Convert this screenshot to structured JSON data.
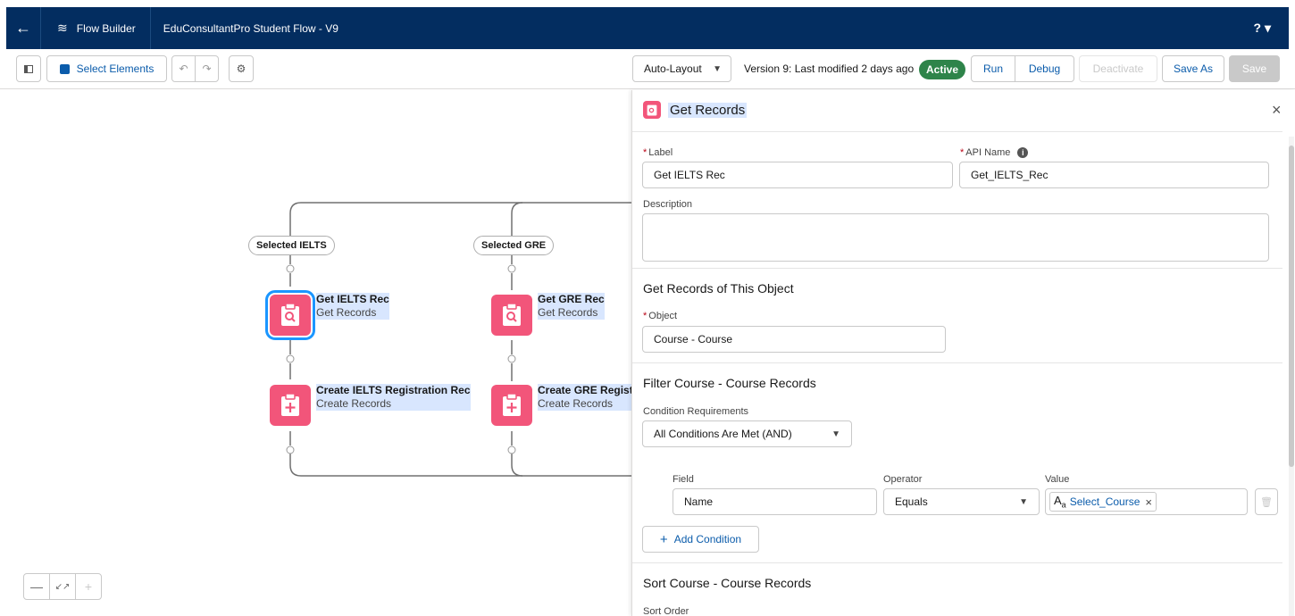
{
  "header": {
    "back_icon": "arrow-left-icon",
    "app_icon": "flow-icon",
    "app_name": "Flow Builder",
    "flow_title": "EduConsultantPro Student Flow - V9",
    "help": "?"
  },
  "toolbar": {
    "select_elements": "Select Elements",
    "layout": "Auto-Layout",
    "version_text": "Version 9: Last modified 2 days ago",
    "status": "Active",
    "run": "Run",
    "debug": "Debug",
    "deactivate": "Deactivate",
    "save_as": "Save As",
    "save": "Save"
  },
  "canvas": {
    "branches": [
      {
        "label": "Selected IELTS",
        "get_title": "Get IELTS Rec",
        "get_type": "Get Records",
        "create_title": "Create IELTS Registration Rec",
        "create_type": "Create Records"
      },
      {
        "label": "Selected GRE",
        "get_title": "Get GRE Rec",
        "get_type": "Get Records",
        "create_title": "Create GRE Regist",
        "create_type": "Create Records"
      }
    ]
  },
  "panel": {
    "title": "Get Records",
    "label_label": "Label",
    "label_value": "Get IELTS Rec",
    "api_label": "API Name",
    "api_value": "Get_IELTS_Rec",
    "description_label": "Description",
    "object_section": "Get Records of This Object",
    "object_label": "Object",
    "object_value": "Course - Course",
    "filter_section": "Filter Course - Course Records",
    "cond_req_label": "Condition Requirements",
    "cond_req_value": "All Conditions Are Met (AND)",
    "field_header": "Field",
    "operator_header": "Operator",
    "value_header": "Value",
    "field_value": "Name",
    "operator_value": "Equals",
    "value_value": "Select_Course",
    "add_condition": "Add Condition",
    "sort_section": "Sort Course - Course Records",
    "sort_order_label": "Sort Order"
  }
}
